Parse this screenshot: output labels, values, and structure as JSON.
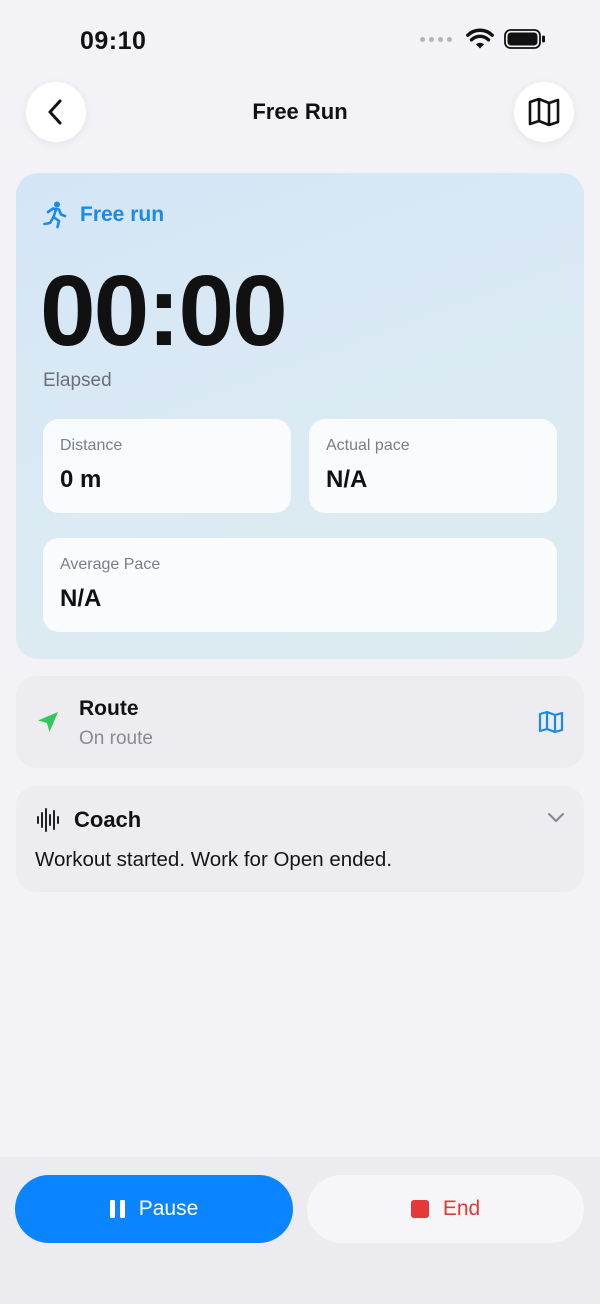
{
  "status_bar": {
    "time": "09:10",
    "icons": [
      "signal-dots-icon",
      "wifi-icon",
      "battery-icon"
    ]
  },
  "nav": {
    "title": "Free Run",
    "back_icon": "chevron-left-icon",
    "map_icon": "map-icon"
  },
  "workout": {
    "mode_icon": "running-figure-icon",
    "mode_label": "Free run",
    "timer": "00:00",
    "timer_label": "Elapsed",
    "stats": {
      "distance": {
        "label": "Distance",
        "value": "0 m"
      },
      "actual_pace": {
        "label": "Actual pace",
        "value": "N/A"
      },
      "average_pace": {
        "label": "Average Pace",
        "value": "N/A"
      }
    }
  },
  "route": {
    "icon": "location-arrow-icon",
    "title": "Route",
    "status": "On route",
    "action_icon": "map-icon"
  },
  "coach": {
    "icon": "waveform-icon",
    "title": "Coach",
    "message": "Workout started. Work for Open ended.",
    "toggle_icon": "chevron-down-icon"
  },
  "actions": {
    "pause_label": "Pause",
    "end_label": "End"
  },
  "colors": {
    "accent": "#0a84ff",
    "mode_blue": "#1a8ae6",
    "route_green": "#34c759",
    "end_red": "#e5383b",
    "background": "#f2f2f7"
  }
}
